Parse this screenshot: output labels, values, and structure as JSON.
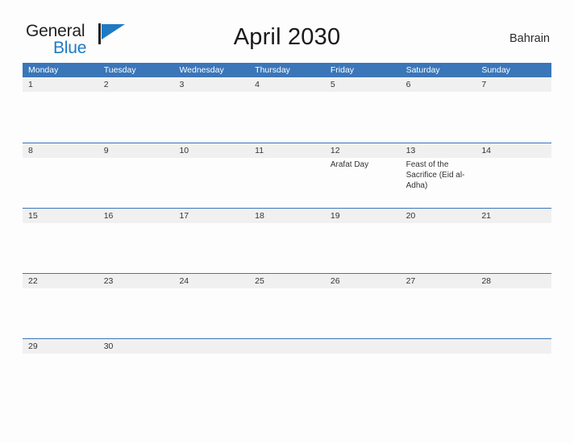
{
  "brand": {
    "line1": "General",
    "line2": "Blue",
    "mark": "blue-triangle-flag",
    "accent_color": "#1f7ac4"
  },
  "header": {
    "title": "April 2030",
    "region": "Bahrain"
  },
  "calendar": {
    "header_color": "#3a76b8",
    "band_color": "#f0f0f0",
    "weekdays": [
      "Monday",
      "Tuesday",
      "Wednesday",
      "Thursday",
      "Friday",
      "Saturday",
      "Sunday"
    ],
    "weeks": [
      [
        {
          "day": "1",
          "events": []
        },
        {
          "day": "2",
          "events": []
        },
        {
          "day": "3",
          "events": []
        },
        {
          "day": "4",
          "events": []
        },
        {
          "day": "5",
          "events": []
        },
        {
          "day": "6",
          "events": []
        },
        {
          "day": "7",
          "events": []
        }
      ],
      [
        {
          "day": "8",
          "events": []
        },
        {
          "day": "9",
          "events": []
        },
        {
          "day": "10",
          "events": []
        },
        {
          "day": "11",
          "events": []
        },
        {
          "day": "12",
          "events": [
            "Arafat Day"
          ]
        },
        {
          "day": "13",
          "events": [
            "Feast of the Sacrifice (Eid al-Adha)"
          ]
        },
        {
          "day": "14",
          "events": []
        }
      ],
      [
        {
          "day": "15",
          "events": []
        },
        {
          "day": "16",
          "events": []
        },
        {
          "day": "17",
          "events": []
        },
        {
          "day": "18",
          "events": []
        },
        {
          "day": "19",
          "events": []
        },
        {
          "day": "20",
          "events": []
        },
        {
          "day": "21",
          "events": []
        }
      ],
      [
        {
          "day": "22",
          "events": []
        },
        {
          "day": "23",
          "events": []
        },
        {
          "day": "24",
          "events": []
        },
        {
          "day": "25",
          "events": []
        },
        {
          "day": "26",
          "events": []
        },
        {
          "day": "27",
          "events": []
        },
        {
          "day": "28",
          "events": []
        }
      ],
      [
        {
          "day": "29",
          "events": []
        },
        {
          "day": "30",
          "events": []
        },
        {
          "day": "",
          "events": []
        },
        {
          "day": "",
          "events": []
        },
        {
          "day": "",
          "events": []
        },
        {
          "day": "",
          "events": []
        },
        {
          "day": "",
          "events": []
        }
      ]
    ]
  }
}
